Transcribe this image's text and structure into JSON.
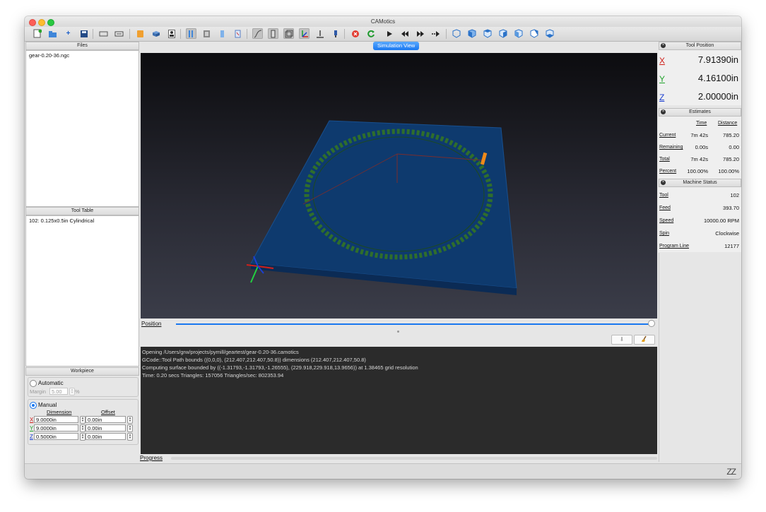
{
  "window": {
    "title": "CAMotics"
  },
  "toolbar": {
    "icons": [
      "new-file-icon",
      "open-project-icon",
      "add-file-icon",
      "save-icon",
      "export-icon",
      "gcode-icon",
      "tool-icon",
      "workpiece-icon",
      "user-icon",
      "path-view-icon",
      "surface-view-icon",
      "box-view-icon",
      "cylinder-view-icon",
      "bbox-view-icon",
      "curve-view-icon",
      "ruler-icon",
      "axes-icon",
      "tool-view-icon",
      "spindle-icon",
      "stop-icon",
      "rerun-icon",
      "play-icon",
      "rewind-icon",
      "forward-icon",
      "step-icon",
      "view-iso-icon",
      "view-front-icon",
      "view-top-icon",
      "view-left-icon",
      "view-right-icon",
      "view-back-icon",
      "view-bottom-icon"
    ]
  },
  "files": {
    "title": "Files",
    "items": [
      "gear-0.20-36.ngc"
    ]
  },
  "tool_table": {
    "title": "Tool Table",
    "items": [
      "102: 0.125x0.5in Cylindrical"
    ]
  },
  "workpiece": {
    "title": "Workpiece",
    "automatic_label": "Automatic",
    "margin_label": "Margin",
    "margin_value": "5.00",
    "margin_unit": "%",
    "manual_label": "Manual",
    "dimension_header": "Dimension",
    "offset_header": "Offset",
    "rows": [
      {
        "axis": "X",
        "dimension": "9.0000in",
        "offset": "0.00in",
        "color": "#d0201b"
      },
      {
        "axis": "Y",
        "dimension": "9.0000in",
        "offset": "0.00in",
        "color": "#23a42d"
      },
      {
        "axis": "Z",
        "dimension": "0.5000in",
        "offset": "0.00in",
        "color": "#1c3fd0"
      }
    ]
  },
  "simulation": {
    "tab_label": "Simulation View"
  },
  "position": {
    "label": "Position",
    "progress": 1.0
  },
  "console": {
    "lines": [
      "Opening /Users/grw/projects/pymill/geartest/gear-0.20-36.camotics",
      "GCode::Tool Path bounds ((0,0,0), (212.407,212.407,50.8)) dimensions (212.407,212.407,50.8)",
      "Computing surface bounded by ((-1.31793,-1.31793,-1.26555), (229.918,229.918,13.9656)) at 1.38465 grid resolution",
      "Time: 0.20 secs Triangles: 157056 Triangles/sec: 802353.94"
    ]
  },
  "progress": {
    "label": "Progress"
  },
  "tool_position": {
    "title": "Tool Position",
    "x_label": "X",
    "x_value": "7.91390in",
    "y_label": "Y",
    "y_value": "4.16100in",
    "z_label": "Z",
    "z_value": "2.00000in"
  },
  "estimates": {
    "title": "Estimates",
    "time_header": "Time",
    "distance_header": "Distance",
    "rows": [
      {
        "label": "Current",
        "time": "7m 42s",
        "distance": "785.20"
      },
      {
        "label": "Remaining",
        "time": "0.00s",
        "distance": "0.00"
      },
      {
        "label": "Total",
        "time": "7m 42s",
        "distance": "785.20"
      },
      {
        "label": "Percent",
        "time": "100.00%",
        "distance": "100.00%"
      }
    ]
  },
  "machine_status": {
    "title": "Machine Status",
    "rows": [
      {
        "label": "Tool",
        "value": "102"
      },
      {
        "label": "Feed",
        "value": "393.70"
      },
      {
        "label": "Speed",
        "value": "10000.00 RPM"
      },
      {
        "label": "Spin",
        "value": "Clockwise"
      },
      {
        "label": "Program Line",
        "value": "12177"
      }
    ]
  },
  "statusbar": {
    "sleep_indicator": "ZZ"
  },
  "colors": {
    "accent": "#1a78f0",
    "workpiece": "#0e3a6e",
    "gear": "#2f6e2c",
    "tool": "#f08a1a"
  }
}
